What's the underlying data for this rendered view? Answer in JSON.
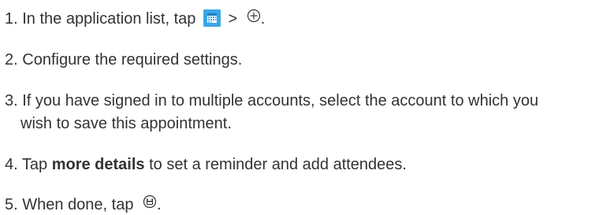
{
  "steps": [
    {
      "num": "1.",
      "text_before": "In the application list, tap",
      "sep": ">",
      "text_after": "."
    },
    {
      "num": "2.",
      "text": "Configure the required settings."
    },
    {
      "num": "3.",
      "line1": "If you have signed in to multiple accounts, select the account to which you",
      "line2": "wish to save this appointment."
    },
    {
      "num": "4.",
      "text_before": "Tap",
      "bold": "more details",
      "text_after": "to set a reminder and add attendees."
    },
    {
      "num": "5.",
      "text_before": "When done, tap",
      "text_after": "."
    }
  ],
  "icons": {
    "calendar": "calendar-app-icon",
    "add": "add-circle-icon",
    "save": "save-circle-icon"
  },
  "colors": {
    "text": "#333333",
    "calendar_icon": "#39a7e6"
  }
}
